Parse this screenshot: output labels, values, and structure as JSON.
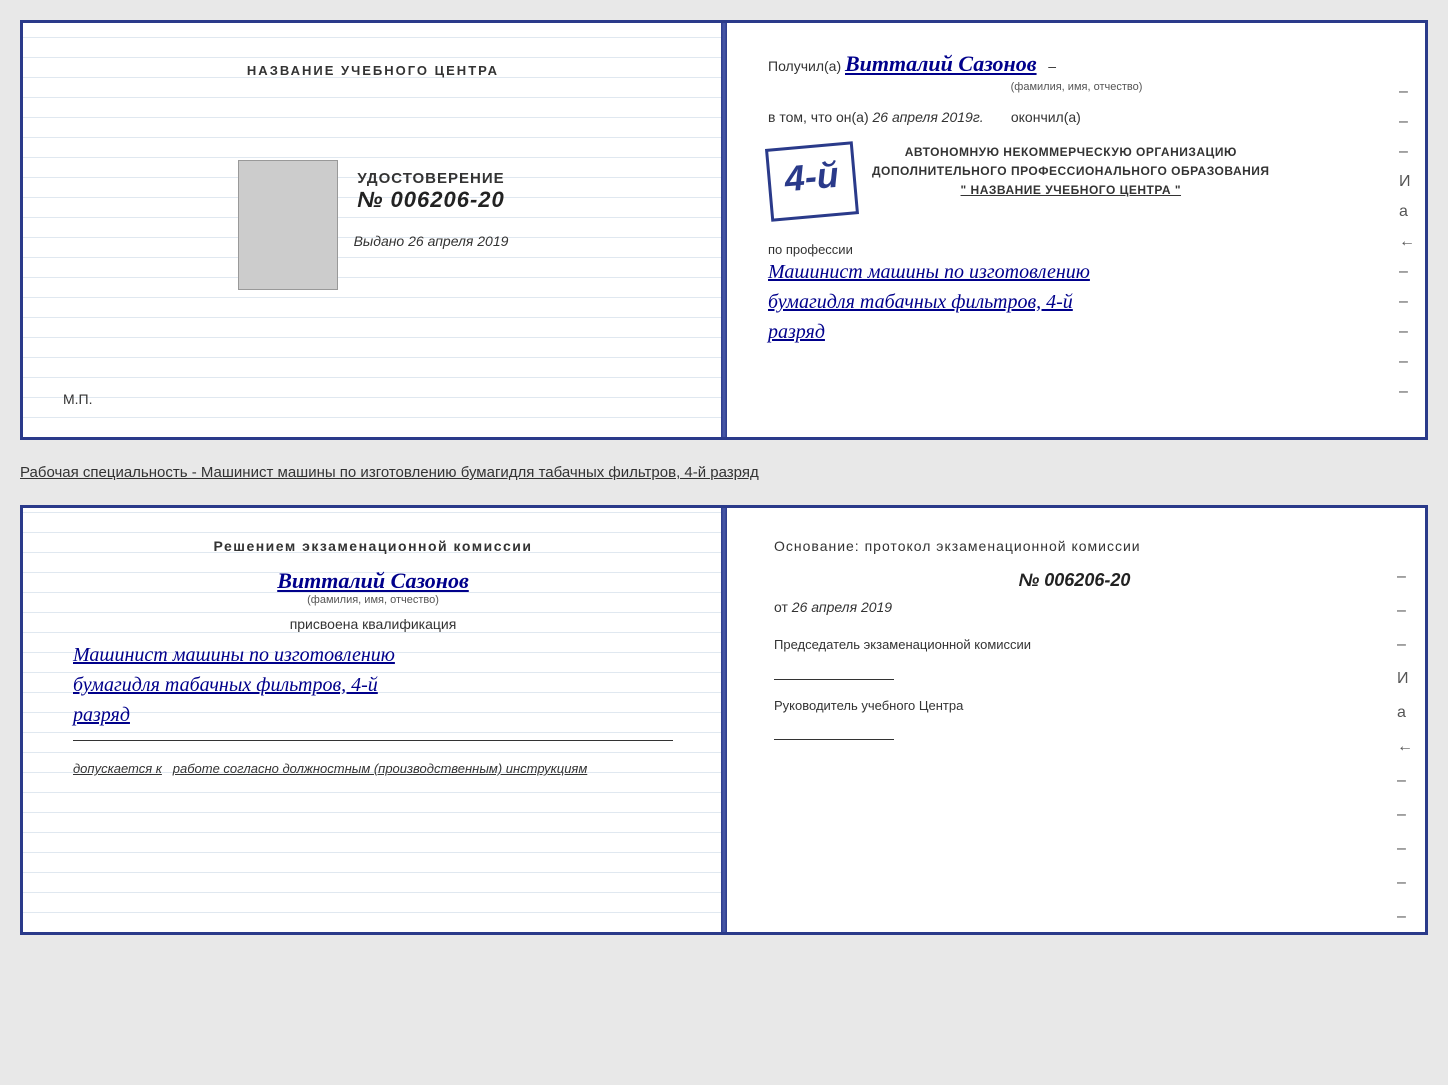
{
  "top_cert": {
    "left": {
      "center_title": "НАЗВАНИЕ УЧЕБНОГО ЦЕНТРА",
      "udostoverenie_label": "УДОСТОВЕРЕНИЕ",
      "udostoverenie_number": "№ 006206-20",
      "vydano_label": "Выдано",
      "vydano_date": "26 апреля 2019",
      "mp_label": "М.П."
    },
    "right": {
      "poluchil_prefix": "Получил(а)",
      "recipient_name": "Витталий Сазонов",
      "fio_subtitle": "(фамилия, имя, отчество)",
      "vtom_prefix": "в том, что он(а)",
      "vtom_date": "26 апреля 2019г.",
      "okonchil": "окончил(а)",
      "stamp_number": "4-й",
      "org_line1": "АВТОНОМНУЮ НЕКОММЕРЧЕСКУЮ ОРГАНИЗАЦИЮ",
      "org_line2": "ДОПОЛНИТЕЛЬНОГО ПРОФЕССИОНАЛЬНОГО ОБРАЗОВАНИЯ",
      "org_line3": "\" НАЗВАНИЕ УЧЕБНОГО ЦЕНТРА \"",
      "po_professii": "по профессии",
      "profession_line1": "Машинист машины по изготовлению",
      "profession_line2": "бумагидля табачных фильтров, 4-й",
      "profession_line3": "разряд",
      "dashes": [
        "-",
        "-",
        "-",
        "И",
        "а",
        "←",
        "-",
        "-",
        "-",
        "-",
        "-"
      ]
    }
  },
  "separator": {
    "text": "Рабочая специальность - Машинист машины по изготовлению бумагидля табачных фильтров, 4-й разряд"
  },
  "bottom_cert": {
    "left": {
      "resheniem": "Решением экзаменационной комиссии",
      "name": "Витталий Сазонов",
      "fio_sub": "(фамилия, имя, отчество)",
      "prisvoena": "присвоена квалификация",
      "profession_line1": "Машинист машины по изготовлению",
      "profession_line2": "бумагидля табачных фильтров, 4-й",
      "profession_line3": "разряд",
      "dopuskaetsya_prefix": "допускается к",
      "dopuskaetsya_text": "работе согласно должностным (производственным) инструкциям"
    },
    "right": {
      "osnovanie": "Основание: протокол экзаменационной комиссии",
      "protocol_number": "№ 006206-20",
      "ot_label": "от",
      "ot_date": "26 апреля 2019",
      "predsedatel_title": "Председатель экзаменационной комиссии",
      "rukovoditel_title": "Руководитель учебного Центра",
      "dashes": [
        "-",
        "-",
        "-",
        "И",
        "а",
        "←",
        "-",
        "-",
        "-",
        "-",
        "-"
      ]
    }
  }
}
